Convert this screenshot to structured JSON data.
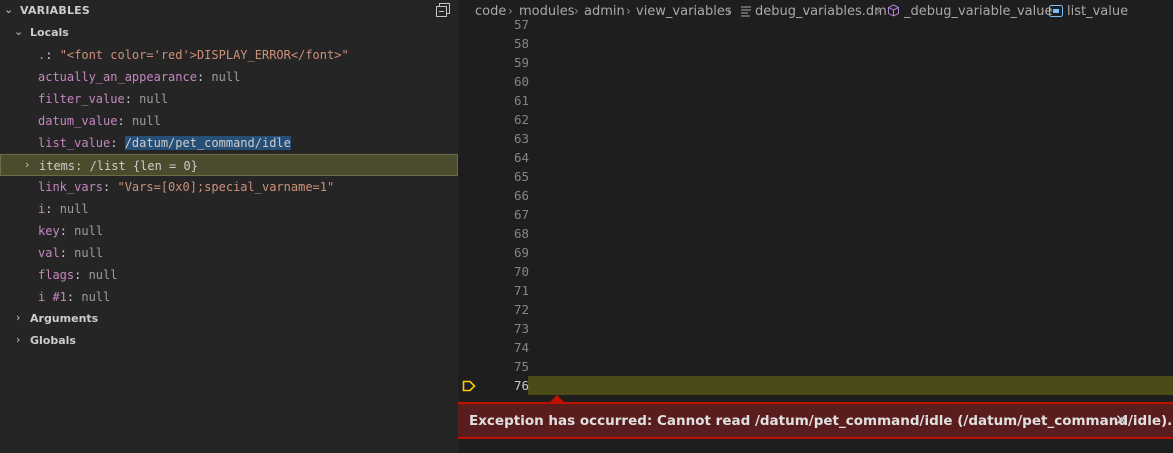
{
  "variables_panel": {
    "title": "VARIABLES",
    "collapse_all_icon": "collapse-all-icon",
    "locals": {
      "label": "Locals",
      "items": [
        {
          "name": ".",
          "sep": ": ",
          "value": "\"<font color='red'>DISPLAY_ERROR</font>\"",
          "kind": "str"
        },
        {
          "name": "actually_an_appearance",
          "sep": ": ",
          "value": "null",
          "kind": "null"
        },
        {
          "name": "filter_value",
          "sep": ": ",
          "value": "null",
          "kind": "null"
        },
        {
          "name": "datum_value",
          "sep": ": ",
          "value": "null",
          "kind": "null"
        },
        {
          "name": "list_value",
          "sep": ": ",
          "value": "/datum/pet_command/idle",
          "kind": "sel"
        },
        {
          "name": "items",
          "sep": ": ",
          "value": "/list {len = 0}",
          "kind": "plain",
          "expandable": true,
          "highlighted": true
        },
        {
          "name": "link_vars",
          "sep": ": ",
          "value": "\"Vars=[0x0];special_varname=1\"",
          "kind": "str"
        },
        {
          "name": "i",
          "sep": ": ",
          "value": "null",
          "kind": "null"
        },
        {
          "name": "key",
          "sep": ": ",
          "value": "null",
          "kind": "null"
        },
        {
          "name": "val",
          "sep": ": ",
          "value": "null",
          "kind": "null"
        },
        {
          "name": "flags",
          "sep": ": ",
          "value": "null",
          "kind": "null"
        },
        {
          "name": "i #1",
          "sep": ": ",
          "value": "null",
          "kind": "null"
        }
      ]
    },
    "arguments_label": "Arguments",
    "globals_label": "Globals"
  },
  "editor": {
    "breadcrumb": {
      "parts": [
        "code",
        "modules",
        "admin",
        "view_variables",
        "debug_variables.dm",
        "_debug_variable_value",
        "list_value"
      ],
      "file_icon": "lines-file-icon",
      "proc_icon": "cube-icon",
      "var_icon": "variable-icon"
    },
    "current_line": 76,
    "line_numbers": [
      "57",
      "58",
      "59",
      "60",
      "61",
      "62",
      "63",
      "64",
      "65",
      "66",
      "67",
      "68",
      "69",
      "70",
      "71",
      "72",
      "73",
      "74",
      "75",
      "76"
    ],
    "exception": {
      "message": "Exception has occurred: Cannot read /datum/pet_command/idle (/datum/pet_command/idle).len",
      "close_icon": "close-icon"
    },
    "colors": {
      "current_line_bg": "#4b4b18",
      "exception_bg": "#5a1d1d",
      "exception_border": "#be1100",
      "breakpoint_arrow": "#ffcc00"
    }
  }
}
